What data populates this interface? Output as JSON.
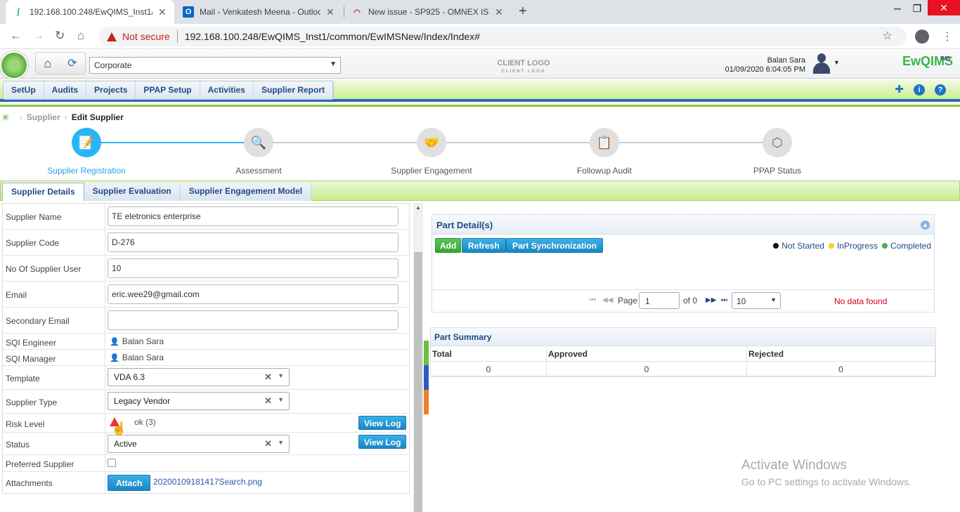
{
  "browser": {
    "tabs": [
      {
        "title": "192.168.100.248/EwQIMS_Inst1/c",
        "icon": "ewqims-favicon"
      },
      {
        "title": "Mail - Venkatesh Meena - Outloo",
        "icon": "outlook-icon"
      },
      {
        "title": "New issue - SP925 - OMNEX ISSU",
        "icon": "redmine-icon"
      }
    ],
    "not_secure": "Not secure",
    "url": "192.168.100.248/EwQIMS_Inst1/common/EwIMSNew/Index/Index#"
  },
  "header": {
    "corporate": "Corporate",
    "client_logo": "CLIENT LOGO",
    "client_logo_sub": "CLIENT LOGO",
    "user_name": "Balan Sara",
    "datetime": "01/09/2020 6:04:05 PM",
    "brand": "EwQIMS",
    "brand_sup": "IMS"
  },
  "menu": {
    "items": [
      "SetUp",
      "Audits",
      "Projects",
      "PPAP Setup",
      "Activities",
      "Supplier Report"
    ]
  },
  "breadcrumb": {
    "parent": "Supplier",
    "current": "Edit Supplier"
  },
  "stepper": {
    "steps": [
      "Supplier Registration",
      "Assessment",
      "Supplier Engagement",
      "Followup Audit",
      "PPAP Status"
    ],
    "active_index": 0
  },
  "tabs": [
    "Supplier Details",
    "Supplier Evaluation",
    "Supplier Engagement Model"
  ],
  "form": {
    "supplier_name": {
      "label": "Supplier Name",
      "value": "TE eletronics enterprise"
    },
    "supplier_code": {
      "label": "Supplier Code",
      "value": "D-276"
    },
    "no_users": {
      "label": "No Of Supplier User",
      "value": "10"
    },
    "email": {
      "label": "Email",
      "value": "eric.wee29@gmail.com"
    },
    "secondary_email": {
      "label": "Secondary Email",
      "value": ""
    },
    "sqi_engineer": {
      "label": "SQI Engineer",
      "value": "Balan Sara"
    },
    "sqi_manager": {
      "label": "SQI Manager",
      "value": "Balan Sara"
    },
    "template": {
      "label": "Template",
      "value": "VDA 6.3"
    },
    "supplier_type": {
      "label": "Supplier Type",
      "value": "Legacy Vendor"
    },
    "risk_level": {
      "label": "Risk Level",
      "value": "ok (3)"
    },
    "status": {
      "label": "Status",
      "value": "Active"
    },
    "preferred": {
      "label": "Preferred Supplier"
    },
    "attachments": {
      "label": "Attachments",
      "file": "20200109181417Search.png"
    },
    "view_log": "View Log",
    "attach": "Attach"
  },
  "part_detail": {
    "title": "Part Detail(s)",
    "add": "Add",
    "refresh": "Refresh",
    "sync": "Part Synchronization",
    "legend": [
      {
        "label": "Not Started",
        "color": "#111111"
      },
      {
        "label": "InProgress",
        "color": "#f2d31b"
      },
      {
        "label": "Completed",
        "color": "#4caf50"
      }
    ],
    "page_label": "Page",
    "page_value": "1",
    "of_label": "of 0",
    "page_size": "10",
    "no_data": "No data found"
  },
  "part_summary": {
    "title": "Part Summary",
    "headers": [
      "Total",
      "Approved",
      "Rejected"
    ],
    "values": [
      "0",
      "0",
      "0"
    ]
  },
  "watermark": {
    "title": "Activate Windows",
    "subtitle": "Go to PC settings to activate Windows."
  }
}
